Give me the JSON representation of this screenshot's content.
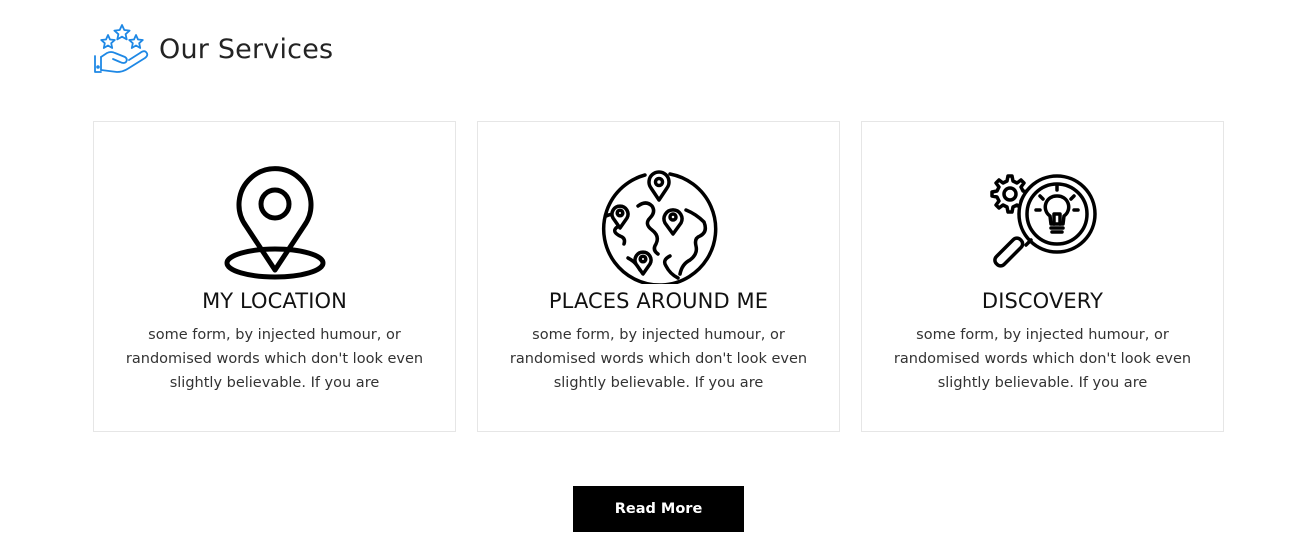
{
  "header": {
    "title": "Our Services",
    "icon": "hand-with-stars-icon",
    "icon_color": "#1e88e5"
  },
  "services": [
    {
      "icon": "map-pin-icon",
      "title": "MY LOCATION",
      "text": "some form, by injected humour, or randomised words which don't look even slightly believable. If you are"
    },
    {
      "icon": "globe-with-pins-icon",
      "title": "PLACES AROUND ME",
      "text": "some form, by injected humour, or randomised words which don't look even slightly believable. If you are"
    },
    {
      "icon": "magnifier-lightbulb-gear-icon",
      "title": "DISCOVERY",
      "text": "some form, by injected humour, or randomised words which don't look even slightly believable. If you are"
    }
  ],
  "read_more_label": "Read More",
  "colors": {
    "button_bg": "#000000",
    "button_text": "#ffffff",
    "card_border": "#e6e6e6"
  }
}
